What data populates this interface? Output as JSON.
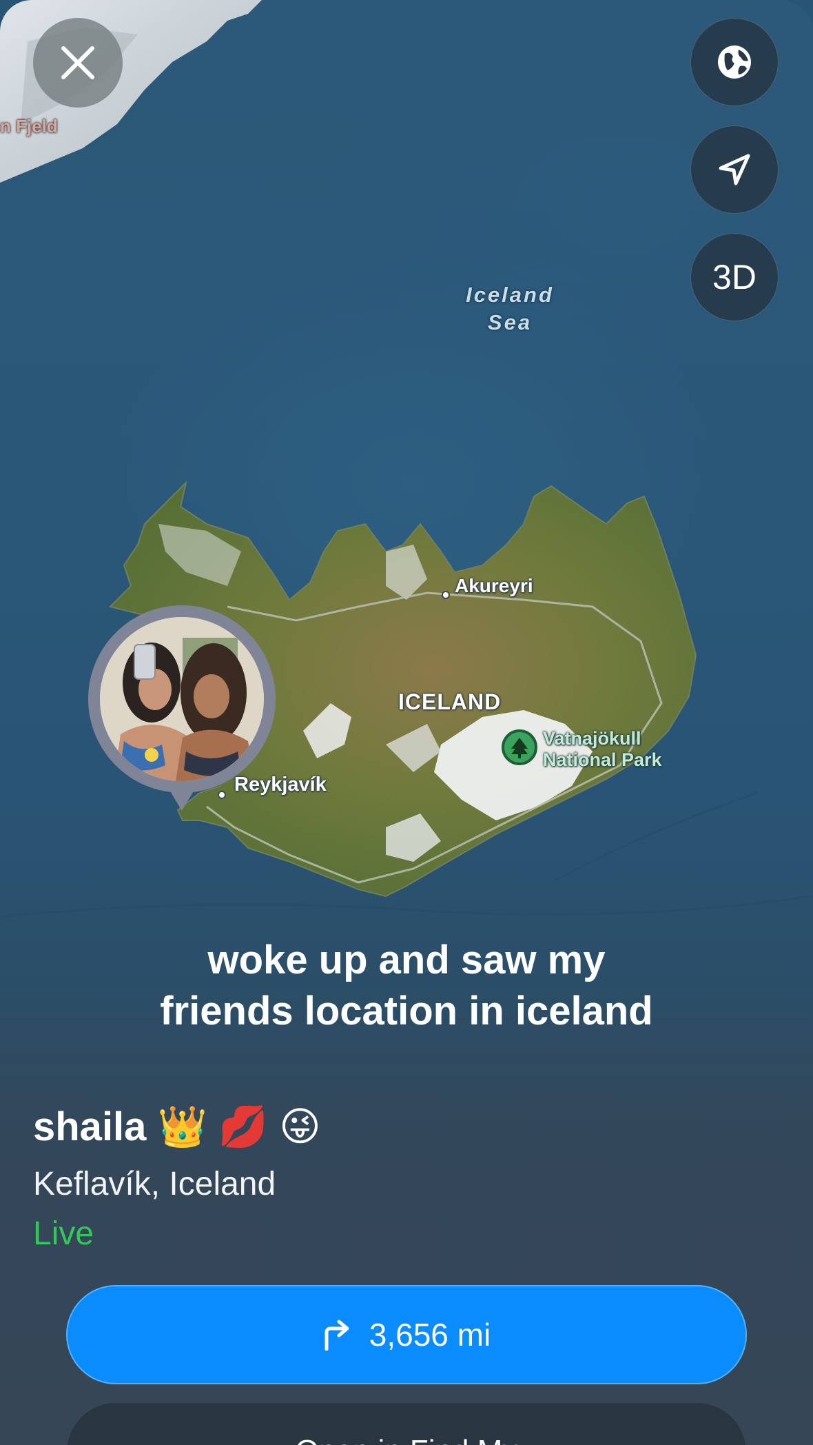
{
  "map": {
    "sea_label": "Iceland Sea",
    "region_label": "n Fjeld",
    "country_label": "ICELAND",
    "cities": [
      {
        "name": "Akureyri"
      },
      {
        "name": "Reykjavík"
      }
    ],
    "park_label": "Vatnajökull National Park",
    "park_line1": "Vatnajökull",
    "park_line2": "National Park"
  },
  "controls": {
    "close_icon": "close-icon",
    "globe_icon": "globe-icon",
    "location_icon": "location-arrow-icon",
    "three_d_label": "3D"
  },
  "caption": {
    "line1": "woke up and saw my",
    "line2": "friends location in iceland"
  },
  "person": {
    "name": "shaila 👑 💋 😜",
    "location": "Keflavík, Iceland",
    "status": "Live"
  },
  "actions": {
    "directions_label": "3,656 mi",
    "directions_icon": "turn-right-arrow-icon",
    "secondary_label": "Open in Find My"
  },
  "colors": {
    "accent": "#0a8cff",
    "live": "#34c759",
    "ocean": "#2a5677"
  }
}
